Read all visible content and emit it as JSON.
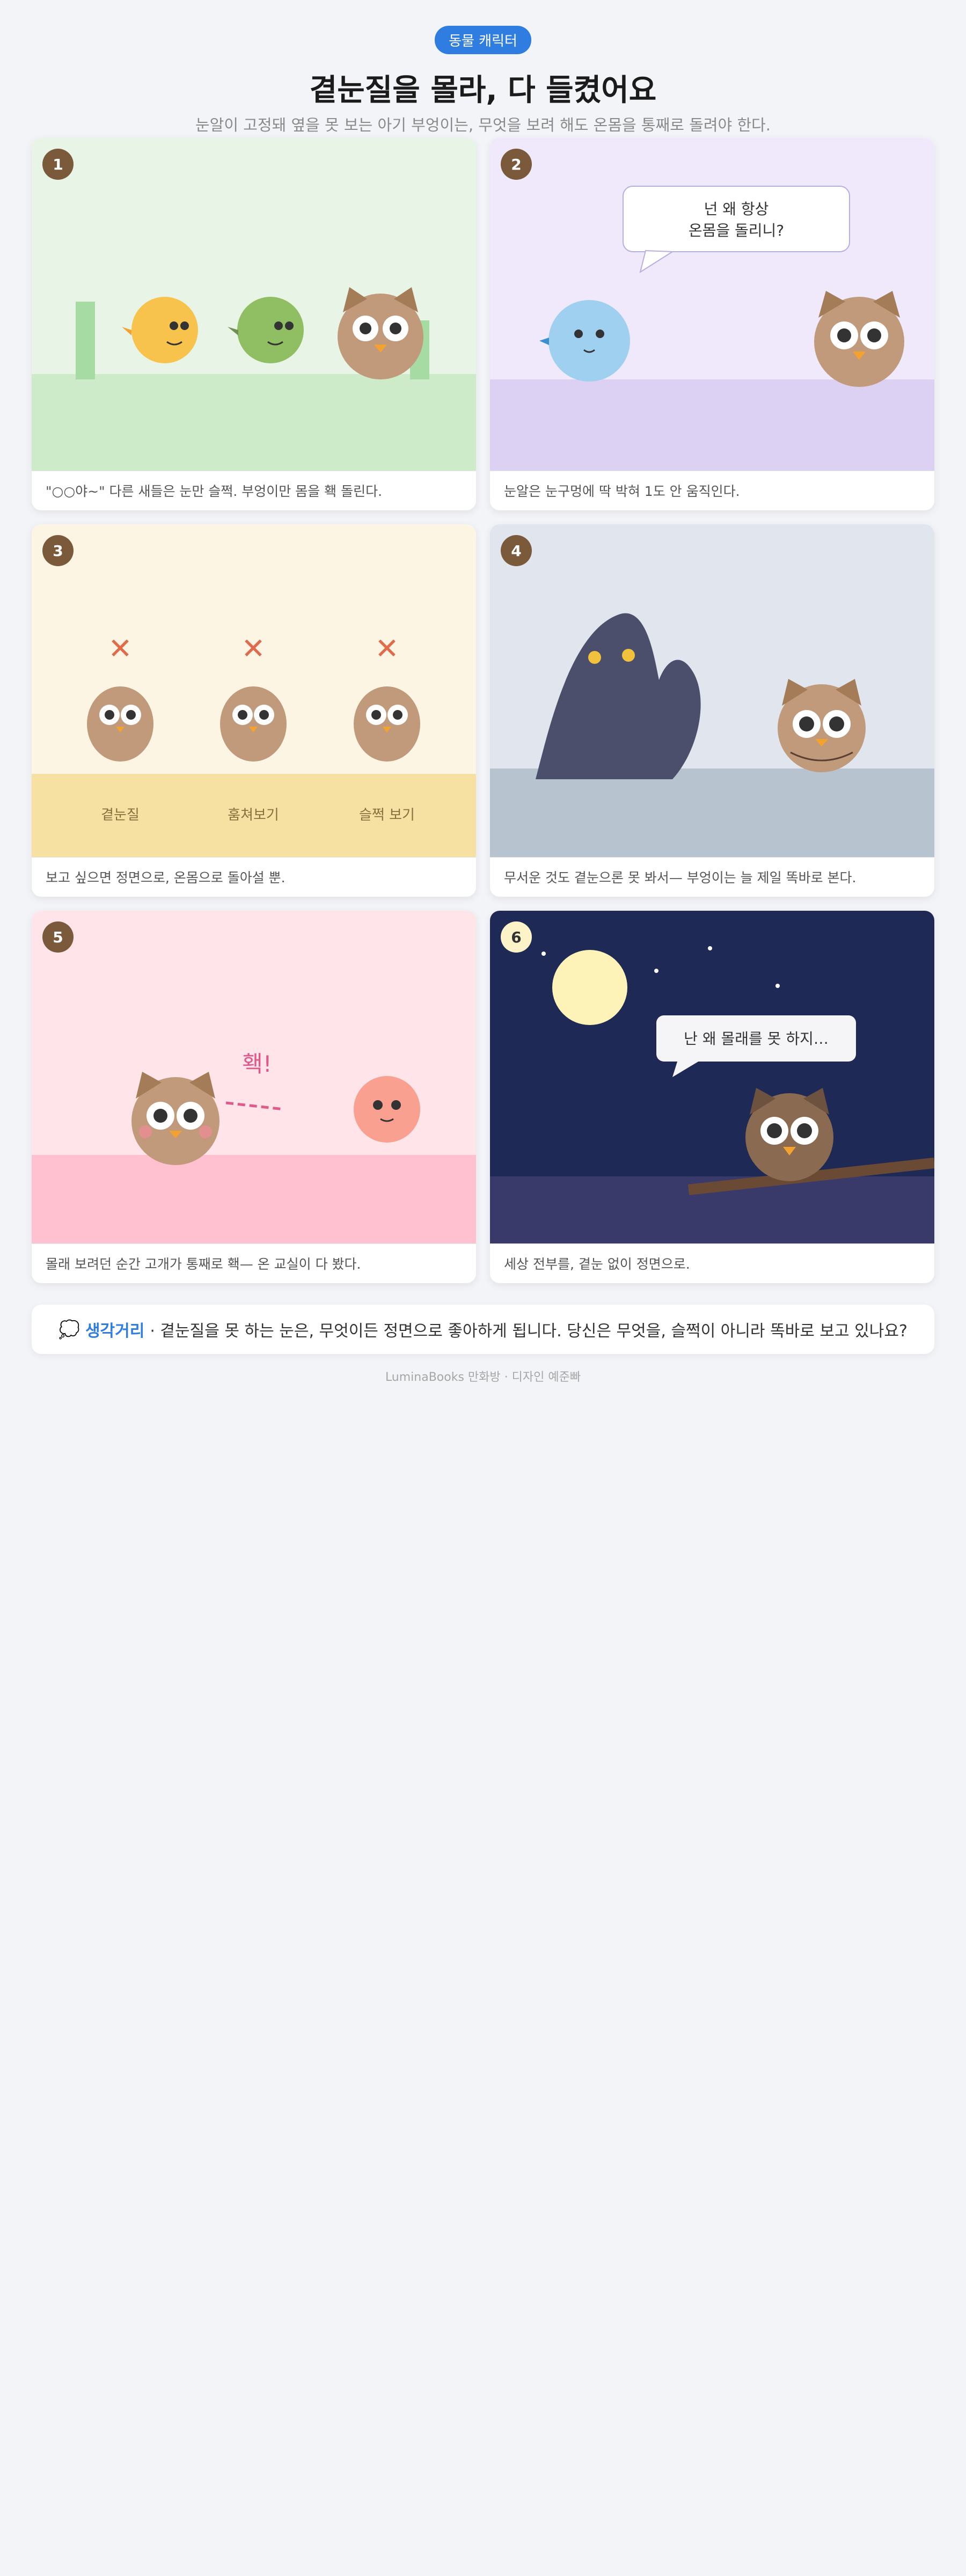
{
  "header": {
    "badge": "동물 캐릭터",
    "title": "곁눈질을 몰라, 다 들켰어요",
    "subtitle": "눈알이 고정돼 옆을 못 보는 아기 부엉이는, 무엇을 보려 해도 온몸을 통째로 돌려야 한다."
  },
  "panels": [
    {
      "num": "1",
      "caption": "\"○○야~\" 다른 새들은 눈만 슬쩍. 부엉이만 몸을 홱 돌린다."
    },
    {
      "num": "2",
      "caption": "눈알은 눈구멍에 딱 박혀 1도 안 움직인다.",
      "speech_line1": "넌 왜 항상",
      "speech_line2": "온몸을 돌리니?"
    },
    {
      "num": "3",
      "caption": "보고 싶으면 정면으로, 온몸으로 돌아설 뿐.",
      "labels": [
        "곁눈질",
        "훔쳐보기",
        "슬쩍 보기"
      ],
      "mark": "✕"
    },
    {
      "num": "4",
      "caption": "무서운 것도 곁눈으론 못 봐서— 부엉이는 늘 제일 똑바로 본다."
    },
    {
      "num": "5",
      "caption": "몰래 보려던 순간 고개가 통째로 홱— 온 교실이 다 봤다.",
      "sfx": "홱!"
    },
    {
      "num": "6",
      "caption": "세상 전부를, 곁눈 없이 정면으로.",
      "speech": "난 왜 몰래를 못 하지…"
    }
  ],
  "footer": {
    "icon": "💭",
    "keyword": "생각거리",
    "text": "· 곁눈질을 못 하는 눈은, 무엇이든 정면으로 좋아하게 됩니다. 당신은 무엇을, 슬쩍이 아니라 똑바로 보고 있나요?",
    "credit": "LuminaBooks 만화방 · 디자인 예준빠"
  },
  "colors": {
    "accent": "#2f7de1",
    "owl": "#c09a7a",
    "night": "#1e2a55"
  }
}
